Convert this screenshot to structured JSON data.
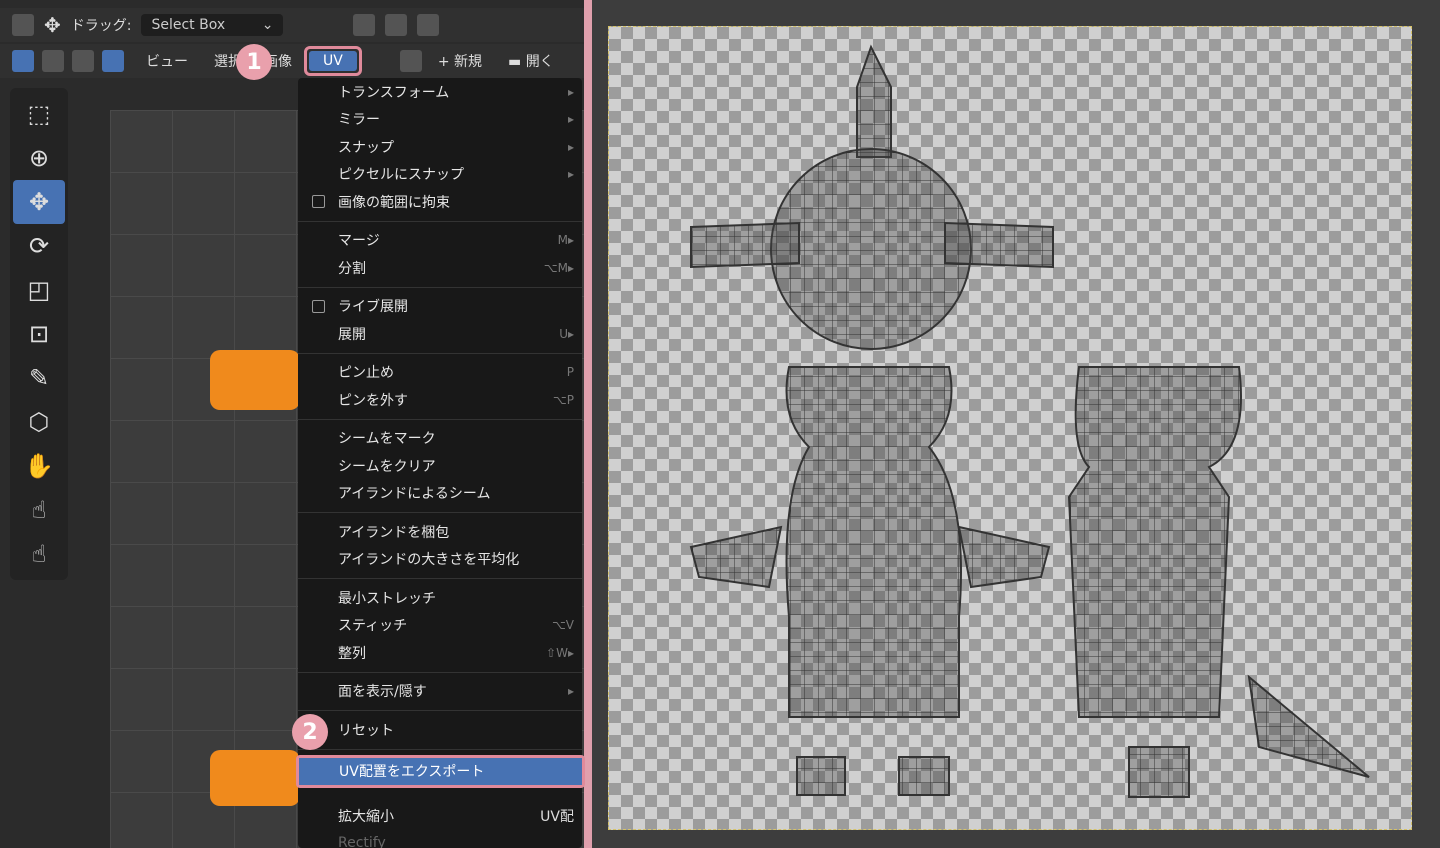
{
  "header": {
    "drag_label": "ドラッグ:",
    "drag_value": "Select Box",
    "view": "ビュー",
    "select": "選択",
    "image": "画像",
    "uv": "UV",
    "new": "新規",
    "open": "開く"
  },
  "badges": {
    "one": "1",
    "two": "2"
  },
  "menu": {
    "items": [
      {
        "label": "トランスフォーム",
        "shortcut": "▸"
      },
      {
        "label": "ミラー",
        "shortcut": "▸"
      },
      {
        "label": "スナップ",
        "shortcut": "▸"
      },
      {
        "label": "ピクセルにスナップ",
        "shortcut": "▸"
      },
      {
        "label": "画像の範囲に拘束",
        "shortcut": ""
      },
      {
        "label": "マージ",
        "shortcut": "M▸"
      },
      {
        "label": "分割",
        "shortcut": "⌥M▸"
      },
      {
        "label": "ライブ展開",
        "shortcut": ""
      },
      {
        "label": "展開",
        "shortcut": "U▸"
      },
      {
        "label": "ピン止め",
        "shortcut": "P"
      },
      {
        "label": "ピンを外す",
        "shortcut": "⌥P"
      },
      {
        "label": "シームをマーク",
        "shortcut": ""
      },
      {
        "label": "シームをクリア",
        "shortcut": ""
      },
      {
        "label": "アイランドによるシーム",
        "shortcut": ""
      },
      {
        "label": "アイランドを梱包",
        "shortcut": ""
      },
      {
        "label": "アイランドの大きさを平均化",
        "shortcut": ""
      },
      {
        "label": "最小ストレッチ",
        "shortcut": ""
      },
      {
        "label": "スティッチ",
        "shortcut": "⌥V"
      },
      {
        "label": "整列",
        "shortcut": "⇧W▸"
      },
      {
        "label": "面を表示/隠す",
        "shortcut": "▸"
      },
      {
        "label": "リセット",
        "shortcut": ""
      },
      {
        "label": "UV配置をエクスポート",
        "shortcut": ""
      }
    ],
    "below": {
      "scale": "拡大縮小",
      "rect": "Rectify",
      "side": "UV配"
    }
  },
  "colors": {
    "accent": "#4772b3",
    "highlight": "#e08a9b",
    "uv_selection": "#f08a1c"
  }
}
